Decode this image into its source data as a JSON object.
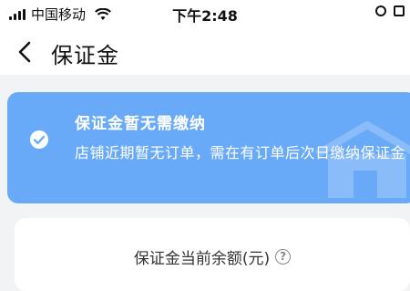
{
  "status_bar": {
    "carrier": "中国移动",
    "time": "下午2:48"
  },
  "nav": {
    "title": "保证金",
    "back_icon": "chevron-left-icon"
  },
  "notice": {
    "title": "保证金暂无需缴纳",
    "description": "店铺近期暂无订单，需在有订单后次日缴纳保证金",
    "background": "#69aaf8",
    "icon": "check-circle-icon"
  },
  "balance": {
    "label": "保证金当前余额(元)",
    "help_icon": "question-circle-icon",
    "help_glyph": "?"
  }
}
